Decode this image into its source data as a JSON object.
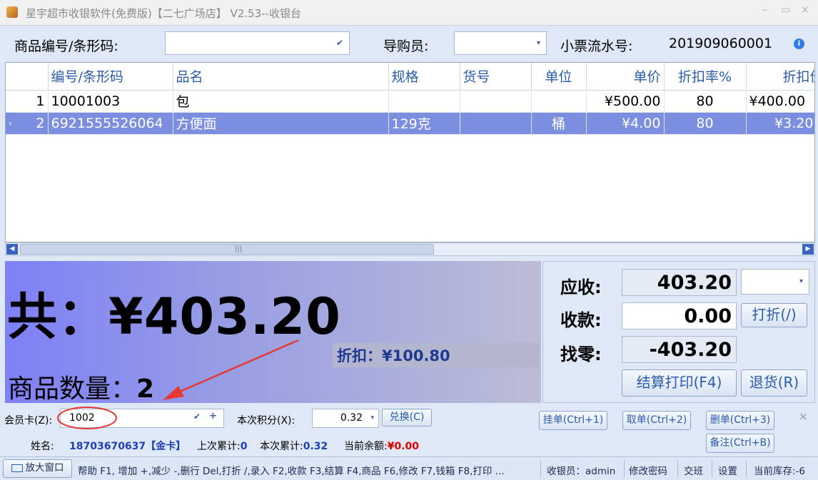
{
  "window": {
    "title": "星宇超市收银软件(免费版)【二七广场店】 V2.53--收银台"
  },
  "toolbar": {
    "barcode_label": "商品编号/条形码:",
    "barcode_value": "",
    "guide_label": "导购员:",
    "guide_value": "",
    "ticket_label": "小票流水号:",
    "ticket_no": "201909060001"
  },
  "grid": {
    "columns": [
      "",
      "编号/条形码",
      "品名",
      "规格",
      "货号",
      "单位",
      "单价",
      "折扣率%",
      "折扣价"
    ],
    "rows": [
      {
        "idx": "1",
        "code": "10001003",
        "name": "包",
        "spec": "",
        "item_no": "",
        "unit": "",
        "price": "¥500.00",
        "rate": "80",
        "disc_price": "¥400.00"
      },
      {
        "idx": "2",
        "code": "6921555526064",
        "name": "方便面",
        "spec": "129克",
        "item_no": "",
        "unit": "桶",
        "price": "¥4.00",
        "rate": "80",
        "disc_price": "¥3.20"
      }
    ]
  },
  "summary": {
    "total_text": "共：¥403.20",
    "discount_text": "折扣：¥100.80",
    "qty_label": "商品数量：",
    "qty_value": "2"
  },
  "payment": {
    "due_label": "应收:",
    "due_value": "403.20",
    "paid_label": "收款:",
    "paid_value": "0.00",
    "change_label": "找零:",
    "change_value": "-403.20",
    "discount_btn": "打折(/)",
    "checkout_btn": "结算打印(F4)",
    "return_btn": "退货(R)"
  },
  "member": {
    "card_label": "会员卡(Z):",
    "card_value": "1002",
    "points_label": "本次积分(X):",
    "points_value": "0.32",
    "exchange_btn": "兑换(C)",
    "name_label": "姓名:",
    "name_value": "18703670637【金卡】",
    "last_total_label": "上次累计:",
    "last_total_value": "0",
    "this_total_label": "本次累计:",
    "this_total_value": "0.32",
    "balance_label": "当前余额:",
    "balance_value": "¥0.00"
  },
  "actions": {
    "hold": "挂单(Ctrl+1)",
    "retrieve": "取单(Ctrl+2)",
    "delete": "删单(Ctrl+3)",
    "note": "备注(Ctrl+B)",
    "close": "×"
  },
  "statusbar": {
    "enlarge": "放大窗口",
    "help": "帮助 F1, 增加 +,减少 -,删行 Del,打折 /,录入 F2,收款 F3,结算 F4,商品 F6,修改 F7,钱箱 F8,打印 ...",
    "cashier": "收银员：admin",
    "change_pwd": "修改密码",
    "shift": "交班",
    "settings": "设置",
    "stock": "当前库存:-6"
  },
  "colors": {
    "accent": "#2a5caa",
    "selected_row": "#7b8ee0",
    "annotation": "#e53935"
  }
}
